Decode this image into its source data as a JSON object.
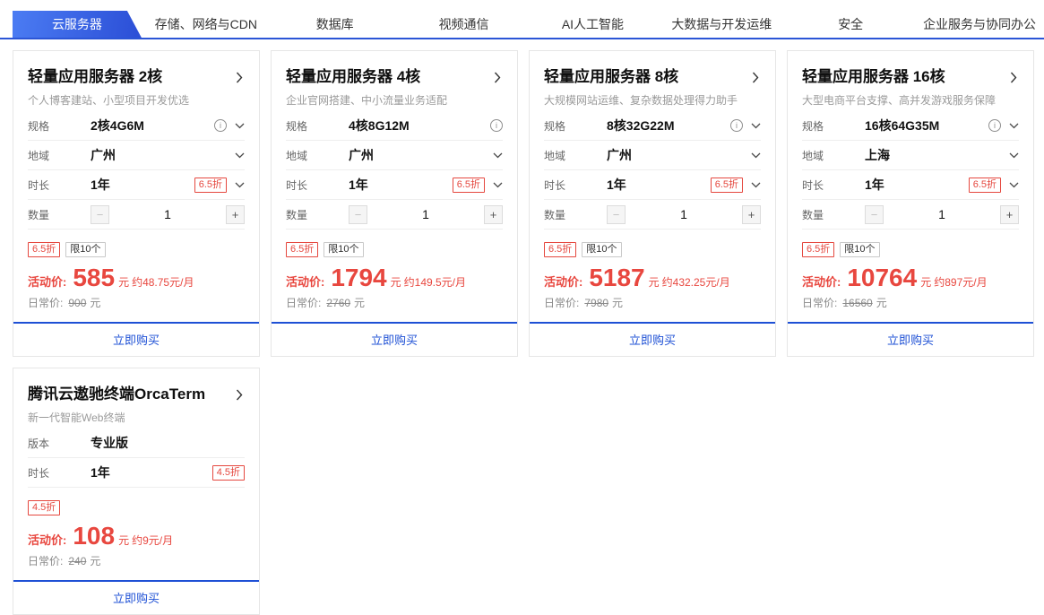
{
  "colors": {
    "accent_blue": "#2b55d6",
    "accent_red": "#e8473f"
  },
  "tabs": [
    {
      "label": "云服务器",
      "active": true
    },
    {
      "label": "存储、网络与CDN",
      "active": false
    },
    {
      "label": "数据库",
      "active": false
    },
    {
      "label": "视频通信",
      "active": false
    },
    {
      "label": "AI人工智能",
      "active": false
    },
    {
      "label": "大数据与开发运维",
      "active": false
    },
    {
      "label": "安全",
      "active": false
    },
    {
      "label": "企业服务与协同办公",
      "active": false
    }
  ],
  "labels": {
    "spec": "规格",
    "region": "地域",
    "duration": "时长",
    "quantity": "数量",
    "version": "版本",
    "activity_price": "活动价:",
    "daily_price": "日常价:",
    "yuan": "元",
    "buy": "立即购买",
    "minus": "−",
    "plus": "+"
  },
  "cards": [
    {
      "title": "轻量应用服务器 2核",
      "subtitle": "个人博客建站、小型项目开发优选",
      "spec": "2核4G6M",
      "region": "广州",
      "duration": "1年",
      "duration_badge": "6.5折",
      "quantity": "1",
      "promo_badge": "6.5折",
      "limit_badge": "限10个",
      "price": "585",
      "monthly": "约48.75元/月",
      "daily": "900"
    },
    {
      "title": "轻量应用服务器 4核",
      "subtitle": "企业官网搭建、中小流量业务适配",
      "spec": "4核8G12M",
      "region": "广州",
      "duration": "1年",
      "duration_badge": "6.5折",
      "quantity": "1",
      "promo_badge": "6.5折",
      "limit_badge": "限10个",
      "price": "1794",
      "monthly": "约149.5元/月",
      "daily": "2760"
    },
    {
      "title": "轻量应用服务器 8核",
      "subtitle": "大规模网站运维、复杂数据处理得力助手",
      "spec": "8核32G22M",
      "region": "广州",
      "duration": "1年",
      "duration_badge": "6.5折",
      "quantity": "1",
      "promo_badge": "6.5折",
      "limit_badge": "限10个",
      "price": "5187",
      "monthly": "约432.25元/月",
      "daily": "7980"
    },
    {
      "title": "轻量应用服务器 16核",
      "subtitle": "大型电商平台支撑、高并发游戏服务保障",
      "spec": "16核64G35M",
      "region": "上海",
      "duration": "1年",
      "duration_badge": "6.5折",
      "quantity": "1",
      "promo_badge": "6.5折",
      "limit_badge": "限10个",
      "price": "10764",
      "monthly": "约897元/月",
      "daily": "16560"
    },
    {
      "title": "腾讯云遨驰终端OrcaTerm",
      "subtitle": "新一代智能Web终端",
      "version": "专业版",
      "duration": "1年",
      "duration_badge": "4.5折",
      "promo_badge": "4.5折",
      "price": "108",
      "monthly": "约9元/月",
      "daily": "240"
    }
  ]
}
